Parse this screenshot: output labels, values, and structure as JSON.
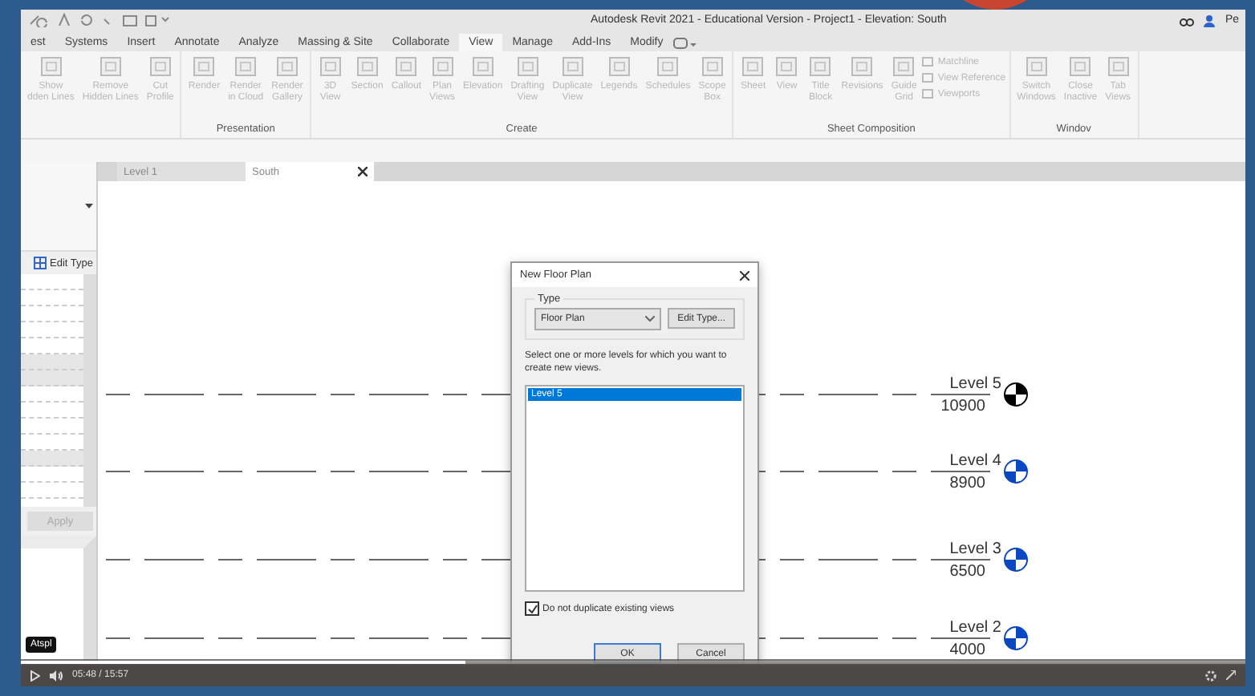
{
  "window": {
    "title": "Autodesk Revit 2021 - Educational Version - Project1 - Elevation: South",
    "user": "Pe"
  },
  "ribbon_tabs": [
    {
      "label": "est",
      "selected": false
    },
    {
      "label": "Systems",
      "selected": false
    },
    {
      "label": "Insert",
      "selected": false
    },
    {
      "label": "Annotate",
      "selected": false
    },
    {
      "label": "Analyze",
      "selected": false
    },
    {
      "label": "Massing & Site",
      "selected": false
    },
    {
      "label": "Collaborate",
      "selected": false
    },
    {
      "label": "View",
      "selected": true
    },
    {
      "label": "Manage",
      "selected": false
    },
    {
      "label": "Add-Ins",
      "selected": false
    },
    {
      "label": "Modify",
      "selected": false
    }
  ],
  "ribbon_panels": [
    {
      "buttons": [
        {
          "kind": "large",
          "lines": [
            "Show",
            "dden Lines"
          ]
        },
        {
          "kind": "large",
          "lines": [
            "Remove",
            "Hidden Lines"
          ]
        },
        {
          "kind": "large",
          "lines": [
            "Cut",
            "Profile"
          ]
        }
      ]
    },
    {
      "title": "Presentation",
      "buttons": [
        {
          "kind": "large",
          "lines": [
            "Render"
          ]
        },
        {
          "kind": "large",
          "lines": [
            "Render",
            "in Cloud"
          ]
        },
        {
          "kind": "large",
          "lines": [
            "Render",
            "Gallery"
          ]
        }
      ]
    },
    {
      "title": "Create",
      "buttons": [
        {
          "kind": "large",
          "lines": [
            "3D",
            "View"
          ]
        },
        {
          "kind": "large",
          "lines": [
            "Section"
          ]
        },
        {
          "kind": "large",
          "lines": [
            "Callout"
          ]
        },
        {
          "kind": "large",
          "lines": [
            "Plan",
            "Views"
          ]
        },
        {
          "kind": "large",
          "lines": [
            "Elevation"
          ]
        },
        {
          "kind": "large",
          "lines": [
            "Drafting",
            "View"
          ]
        },
        {
          "kind": "large",
          "lines": [
            "Duplicate",
            "View"
          ]
        },
        {
          "kind": "large",
          "lines": [
            "Legends"
          ]
        },
        {
          "kind": "large",
          "lines": [
            "Schedules"
          ]
        },
        {
          "kind": "large",
          "lines": [
            "Scope",
            "Box"
          ]
        }
      ]
    },
    {
      "title": "Sheet Composition",
      "buttons": [
        {
          "kind": "large",
          "lines": [
            "Sheet"
          ]
        },
        {
          "kind": "large",
          "lines": [
            "View"
          ]
        },
        {
          "kind": "large",
          "lines": [
            "Title",
            "Block"
          ]
        },
        {
          "kind": "large",
          "lines": [
            "Revisions"
          ]
        },
        {
          "kind": "large",
          "lines": [
            "Guide",
            "Grid"
          ]
        },
        {
          "kind": "small",
          "lines": [
            "Matchline",
            "View Reference",
            "Viewports"
          ]
        }
      ]
    },
    {
      "title": "Windov",
      "buttons": [
        {
          "kind": "large",
          "lines": [
            "Switch",
            "Windows"
          ]
        },
        {
          "kind": "large",
          "lines": [
            "Close",
            "Inactive"
          ]
        },
        {
          "kind": "large",
          "lines": [
            "Tab",
            "Views"
          ]
        }
      ]
    }
  ],
  "properties": {
    "edit_type": "Edit Type",
    "apply": "Apply"
  },
  "view_tabs": [
    {
      "label": "Level 1",
      "selected": false
    },
    {
      "label": "South",
      "selected": true
    }
  ],
  "levels": [
    {
      "name": "Level 5",
      "elevation": "10900",
      "selected": true
    },
    {
      "name": "Level 4",
      "elevation": "8900",
      "selected": false
    },
    {
      "name": "Level 3",
      "elevation": "6500",
      "selected": false
    },
    {
      "name": "Level 2",
      "elevation": "4000",
      "selected": false
    }
  ],
  "dialog": {
    "title": "New Floor Plan",
    "group_label": "Type",
    "type_value": "Floor Plan",
    "edit_type_button": "Edit Type...",
    "instruction": "Select one or more levels for which you want to create new views.",
    "level_list": [
      {
        "label": "Level 5",
        "selected": true
      }
    ],
    "checkbox": {
      "label": "Do not duplicate existing views",
      "checked": true
    },
    "buttons": [
      {
        "label": "OK",
        "default": true
      },
      {
        "label": "Cancel",
        "default": false
      }
    ]
  },
  "video": {
    "tooltip": "Atspl",
    "time": "05:48 / 15:57",
    "progress": {
      "level": 0.363
    }
  }
}
